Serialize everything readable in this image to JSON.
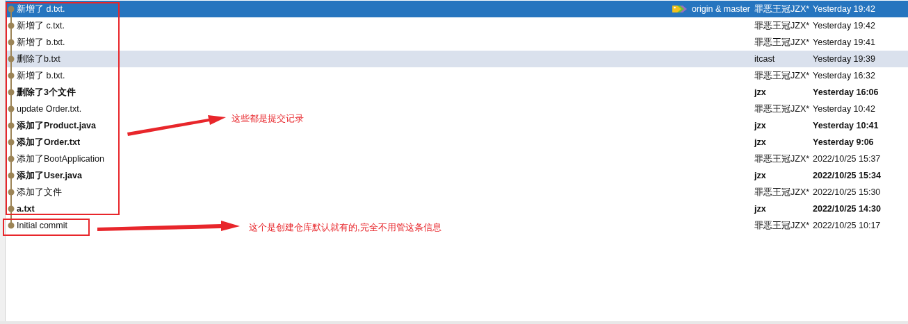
{
  "commits": [
    {
      "message": "新增了 d.txt.",
      "tags": "origin & master",
      "author": "罪恶王冠JZX*",
      "date": "Yesterday 19:42",
      "selected": true,
      "highlighted": false,
      "bold": false
    },
    {
      "message": "新增了 c.txt.",
      "author": "罪恶王冠JZX*",
      "date": "Yesterday 19:42",
      "selected": false,
      "highlighted": false,
      "bold": false
    },
    {
      "message": "新增了 b.txt.",
      "author": "罪恶王冠JZX*",
      "date": "Yesterday 19:41",
      "selected": false,
      "highlighted": false,
      "bold": false
    },
    {
      "message": "删除了b.txt",
      "author": "itcast",
      "date": "Yesterday 19:39",
      "selected": false,
      "highlighted": true,
      "bold": false
    },
    {
      "message": "新增了 b.txt.",
      "author": "罪恶王冠JZX*",
      "date": "Yesterday 16:32",
      "selected": false,
      "highlighted": false,
      "bold": false
    },
    {
      "message": "删除了3个文件",
      "author": "jzx",
      "date": "Yesterday 16:06",
      "selected": false,
      "highlighted": false,
      "bold": true
    },
    {
      "message": "update Order.txt.",
      "author": "罪恶王冠JZX*",
      "date": "Yesterday 10:42",
      "selected": false,
      "highlighted": false,
      "bold": false
    },
    {
      "message": "添加了Product.java",
      "author": "jzx",
      "date": "Yesterday 10:41",
      "selected": false,
      "highlighted": false,
      "bold": true
    },
    {
      "message": "添加了Order.txt",
      "author": "jzx",
      "date": "Yesterday 9:06",
      "selected": false,
      "highlighted": false,
      "bold": true
    },
    {
      "message": "添加了BootApplication",
      "author": "罪恶王冠JZX*",
      "date": "2022/10/25 15:37",
      "selected": false,
      "highlighted": false,
      "bold": false
    },
    {
      "message": "添加了User.java",
      "author": "jzx",
      "date": "2022/10/25 15:34",
      "selected": false,
      "highlighted": false,
      "bold": true
    },
    {
      "message": "添加了文件",
      "author": "罪恶王冠JZX*",
      "date": "2022/10/25 15:30",
      "selected": false,
      "highlighted": false,
      "bold": false
    },
    {
      "message": "a.txt",
      "author": "jzx",
      "date": "2022/10/25 14:30",
      "selected": false,
      "highlighted": false,
      "bold": true
    },
    {
      "message": "Initial commit",
      "author": "罪恶王冠JZX*",
      "date": "2022/10/25 10:17",
      "selected": false,
      "highlighted": false,
      "bold": false
    }
  ],
  "annotations": [
    {
      "text": "这些都是提交记录"
    },
    {
      "text": "这个是创建仓库默认就有的,完全不用管这条信息"
    }
  ]
}
